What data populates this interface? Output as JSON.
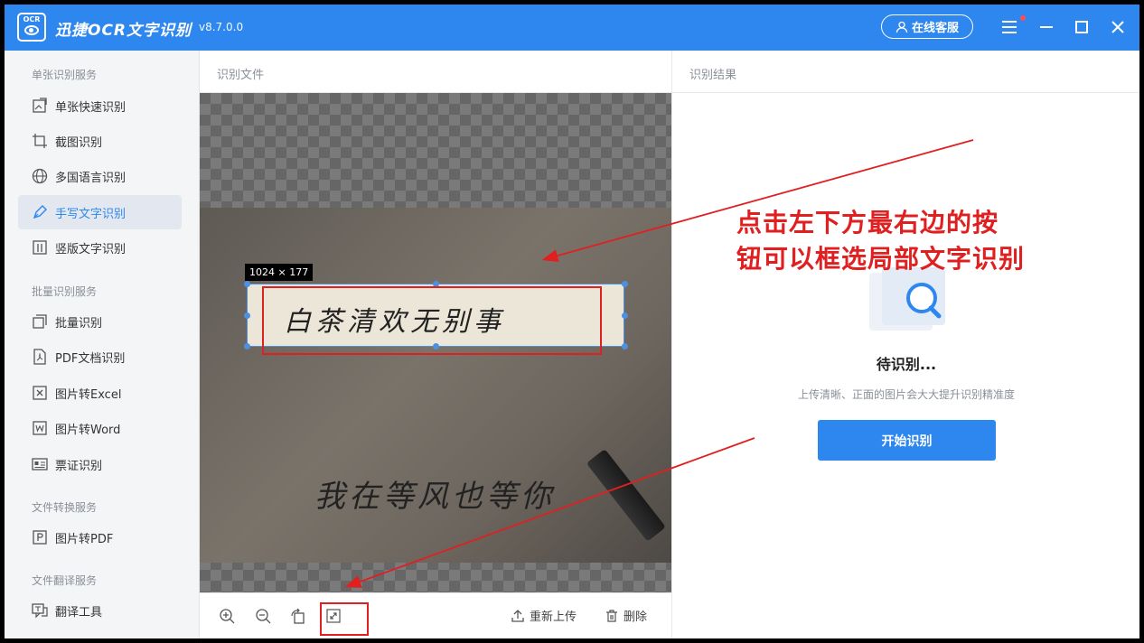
{
  "app": {
    "logo_text": "OCR",
    "title": "迅捷OCR文字识别",
    "version": "v8.7.0.0",
    "online_service": "在线客服"
  },
  "sidebar": {
    "sections": [
      {
        "title": "单张识别服务",
        "items": [
          {
            "label": "单张快速识别",
            "icon": "image-scan-icon"
          },
          {
            "label": "截图识别",
            "icon": "crop-icon"
          },
          {
            "label": "多国语言识别",
            "icon": "globe-icon"
          },
          {
            "label": "手写文字识别",
            "icon": "pen-icon",
            "active": true
          },
          {
            "label": "竖版文字识别",
            "icon": "vertical-text-icon"
          }
        ]
      },
      {
        "title": "批量识别服务",
        "items": [
          {
            "label": "批量识别",
            "icon": "batch-icon"
          },
          {
            "label": "PDF文档识别",
            "icon": "pdf-icon"
          },
          {
            "label": "图片转Excel",
            "icon": "excel-icon"
          },
          {
            "label": "图片转Word",
            "icon": "word-icon"
          },
          {
            "label": "票证识别",
            "icon": "id-card-icon"
          }
        ]
      },
      {
        "title": "文件转换服务",
        "items": [
          {
            "label": "图片转PDF",
            "icon": "pdf-convert-icon"
          }
        ]
      },
      {
        "title": "文件翻译服务",
        "items": [
          {
            "label": "翻译工具",
            "icon": "translate-icon"
          }
        ]
      }
    ]
  },
  "file_panel": {
    "header": "识别文件",
    "selection_size": "1024 × 177",
    "handwriting_line1": "白茶清欢无别事",
    "handwriting_line2": "我在等风也等你",
    "reupload_label": "重新上传",
    "delete_label": "删除"
  },
  "result_panel": {
    "header": "识别结果",
    "status": "待识别...",
    "hint": "上传清晰、正面的图片会大大提升识别精准度",
    "start_button": "开始识别"
  },
  "annotation": {
    "line1": "点击左下方最右边的按",
    "line2": "钮可以框选局部文字识别",
    "color": "#e02020"
  },
  "colors": {
    "brand": "#2e87ee",
    "active_bg": "#e3e8f0"
  }
}
